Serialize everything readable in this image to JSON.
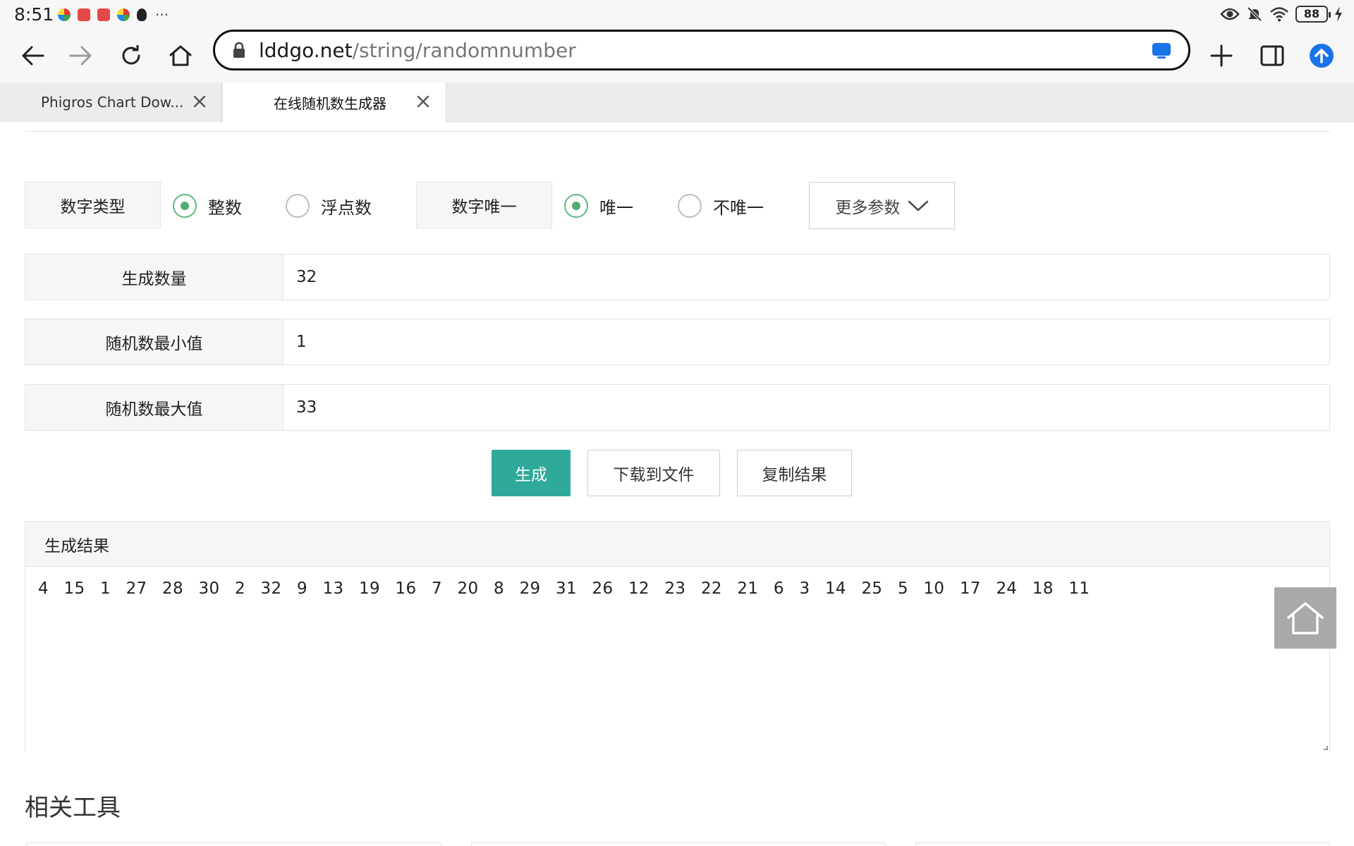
{
  "status_bar": {
    "time": "8:51",
    "more": "···",
    "battery": "88"
  },
  "browser": {
    "url_host": "lddgo.net",
    "url_path": "/string/randomnumber",
    "tabs": [
      {
        "title": "Phigros Chart Dow...",
        "active": false
      },
      {
        "title": "在线随机数生成器",
        "active": true
      }
    ]
  },
  "options": {
    "number_type_label": "数字类型",
    "integer_label": "整数",
    "float_label": "浮点数",
    "unique_label": "数字唯一",
    "unique_yes_label": "唯一",
    "unique_no_label": "不唯一",
    "more_params_label": "更多参数"
  },
  "fields": {
    "count": {
      "label": "生成数量",
      "value": "32"
    },
    "min": {
      "label": "随机数最小值",
      "value": "1"
    },
    "max": {
      "label": "随机数最大值",
      "value": "33"
    }
  },
  "actions": {
    "generate": "生成",
    "download": "下载到文件",
    "copy": "复制结果"
  },
  "result": {
    "title": "生成结果",
    "text": "4 15 1 27 28 30 2 32 9 13 19 16 7 20 8 29 31 26 12 23 22 21 6 3 14 25 5 10 17 24 18 11"
  },
  "related": {
    "title": "相关工具"
  },
  "colors": {
    "primary_button": "#2fa99a",
    "radio_checked": "#4fae6f",
    "cast_icon": "#1a73e8",
    "update_icon": "#1a73e8"
  }
}
